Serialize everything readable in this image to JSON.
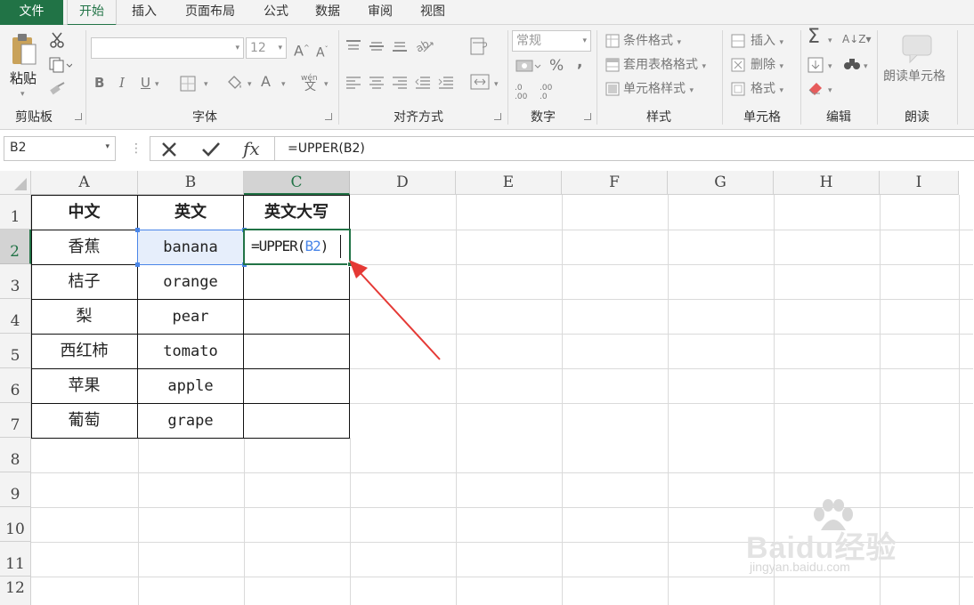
{
  "tabs": [
    {
      "key": "file",
      "label": "文件"
    },
    {
      "key": "home",
      "label": "开始"
    },
    {
      "key": "insert",
      "label": "插入"
    },
    {
      "key": "layout",
      "label": "页面布局"
    },
    {
      "key": "formulas",
      "label": "公式"
    },
    {
      "key": "data",
      "label": "数据"
    },
    {
      "key": "review",
      "label": "审阅"
    },
    {
      "key": "view",
      "label": "视图"
    }
  ],
  "ribbon": {
    "clipboard": {
      "paste": "粘贴",
      "label": "剪贴板"
    },
    "font": {
      "size": "12",
      "label": "字体",
      "bold": "B",
      "italic": "I",
      "underline": "U",
      "font_color": "A",
      "pinyin": "wén"
    },
    "alignment": {
      "label": "对齐方式"
    },
    "number": {
      "format": "常规",
      "percent": "%",
      "comma": ",",
      "inc_decimal": ".0\n.00",
      "dec_decimal": ".00\n.0",
      "label": "数字"
    },
    "styles": {
      "conditional": "条件格式",
      "table": "套用表格格式",
      "cell": "单元格样式",
      "label": "样式"
    },
    "cells": {
      "insert": "插入",
      "delete": "删除",
      "format": "格式",
      "label": "单元格"
    },
    "editing": {
      "label": "编辑"
    },
    "read": {
      "button": "朗读单元格",
      "label": "朗读"
    }
  },
  "formula_bar": {
    "name_box": "B2",
    "fx": "fx",
    "formula": "=UPPER(B2)"
  },
  "sheet": {
    "columns": [
      "A",
      "B",
      "C",
      "D",
      "E",
      "F",
      "G",
      "H",
      "I"
    ],
    "rows": [
      "1",
      "2",
      "3",
      "4",
      "5",
      "6",
      "7",
      "8",
      "9",
      "10",
      "11",
      "12"
    ],
    "active_column": "C",
    "active_row": "2",
    "cells": {
      "A1": "中文",
      "B1": "英文",
      "C1": "英文大写",
      "A2": "香蕉",
      "B2": "banana",
      "A3": "桔子",
      "B3": "orange",
      "A4": "梨",
      "B4": "pear",
      "A5": "西红柿",
      "B5": "tomato",
      "A6": "苹果",
      "B6": "apple",
      "A7": "葡萄",
      "B7": "grape"
    },
    "edit_cell": {
      "prefix": "=UPPER(",
      "ref": "B2",
      "suffix": ")"
    }
  },
  "colors": {
    "accent": "#217346",
    "ref_highlight": "#4a86e8",
    "annotation_arrow": "#e53935"
  },
  "watermark": {
    "brand": "Baidu经验",
    "url": "jingyan.baidu.com"
  }
}
